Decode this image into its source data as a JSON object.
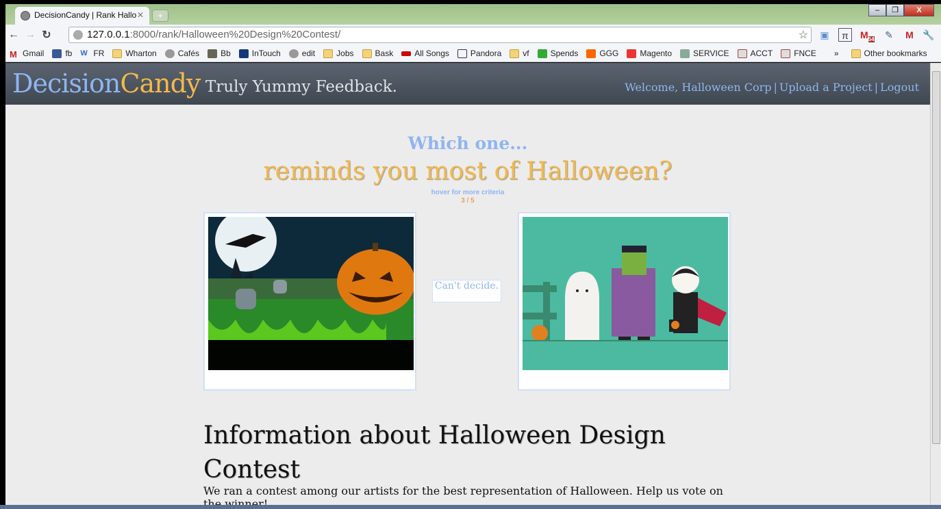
{
  "browser": {
    "tab_title": "DecisionCandy | Rank Hallo",
    "url_host": "127.0.0.1",
    "url_rest": ":8000/rank/Halloween%20Design%20Contest/",
    "gmail_badge": "54",
    "bookmarks": [
      "Gmail",
      "fb",
      "FR",
      "Wharton",
      "Cafés",
      "Bb",
      "InTouch",
      "edit",
      "Jobs",
      "Bask",
      "All Songs",
      "Pandora",
      "vf",
      "Spends",
      "GGG",
      "Magento",
      "SERVICE",
      "ACCT",
      "FNCE"
    ],
    "overflow": "»",
    "other_bookmarks": "Other bookmarks"
  },
  "header": {
    "logo_part1": "Decision",
    "logo_part2": "Candy",
    "tagline": "Truly Yummy Feedback.",
    "welcome": "Welcome, Halloween Corp",
    "upload": "Upload a Project",
    "logout": "Logout",
    "sep": "|"
  },
  "question": {
    "prefix": "Which one...",
    "criterion": "reminds you most of Halloween?",
    "hint": "hover for more criteria",
    "progress": "3 / 5"
  },
  "cant_decide": "Can't decide.",
  "info": {
    "title": "Information about Halloween Design Contest",
    "description": "We ran a contest among our artists for the best representation of Halloween. Help us vote on the winner!"
  }
}
